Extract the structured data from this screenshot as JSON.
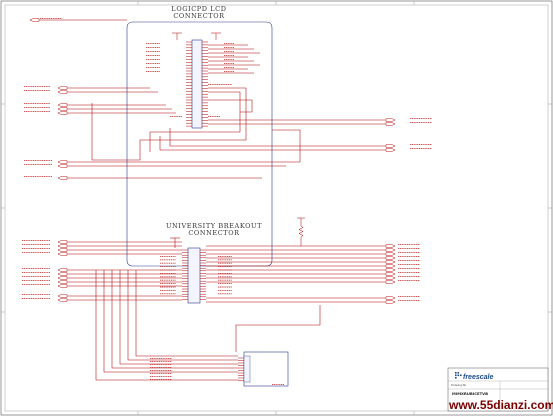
{
  "connectors": {
    "lcd_title": [
      "LOGICPD LCD",
      "CONNECTOR"
    ],
    "breakout_title": [
      "UNIVERSITY BREAKOUT",
      "CONNECTOR"
    ]
  },
  "title_block": {
    "brand": "freescale",
    "board": "MIMXRUBICETVB",
    "drawn_label": "Drawing No."
  },
  "watermark": "www.55dianzi.com",
  "colors": {
    "wire": "#b00000",
    "box": "#2a3a8a",
    "text": "#333333",
    "watermark": "#7a0000"
  }
}
